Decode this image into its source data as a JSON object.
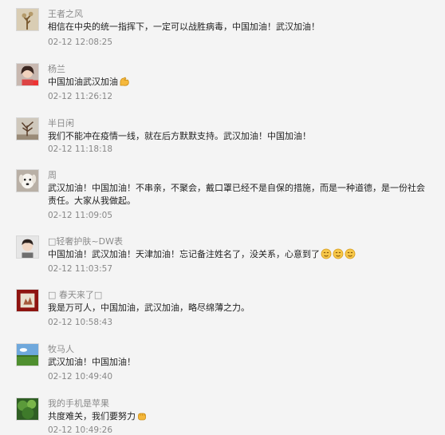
{
  "comments": [
    {
      "name": "王者之风",
      "text": "相信在中央的统一指挥下，一定可以战胜病毒，中国加油！武汉加油！",
      "time": "02-12 12:08:25",
      "avatar_icon": "landscape-tree-avatar"
    },
    {
      "name": "杨兰",
      "text": "中国加油武汉加油",
      "time": "02-12 11:26:12",
      "avatar_icon": "girl-portrait-avatar",
      "emoji": "flexed-biceps-emoji"
    },
    {
      "name": "半日闲",
      "text": "我们不能冲在疫情一线，就在后方默默支持。武汉加油！中国加油！",
      "time": "02-12 11:18:18",
      "avatar_icon": "bare-tree-avatar"
    },
    {
      "name": "周",
      "text": "武汉加油！中国加油！不串亲，不聚会，戴口罩已经不是自保的措施，而是一种道德，是一份社会责任。大家从我做起。",
      "time": "02-12 11:09:05",
      "avatar_icon": "white-dog-avatar"
    },
    {
      "name": "□轻奢护肤~DW表",
      "text": "中国加油！武汉加油！天津加油！忘记备注姓名了，没关系，心意到了",
      "time": "02-12 11:03:57",
      "avatar_icon": "boy-portrait-avatar",
      "emoji": "smile-face-emoji"
    },
    {
      "name": "□ 春天来了□",
      "text": "我是万可人，中国加油，武汉加油，略尽绵薄之力。",
      "time": "02-12 10:58:43",
      "avatar_icon": "framed-red-picture-avatar"
    },
    {
      "name": "牧马人",
      "text": "武汉加油！中国加油！",
      "time": "02-12 10:49:40",
      "avatar_icon": "grassland-sky-avatar"
    },
    {
      "name": "我的手机是苹果",
      "text": "共度难关，我们要努力",
      "time": "02-12 10:49:26",
      "avatar_icon": "green-forest-avatar",
      "emoji": "fist-emoji"
    }
  ]
}
